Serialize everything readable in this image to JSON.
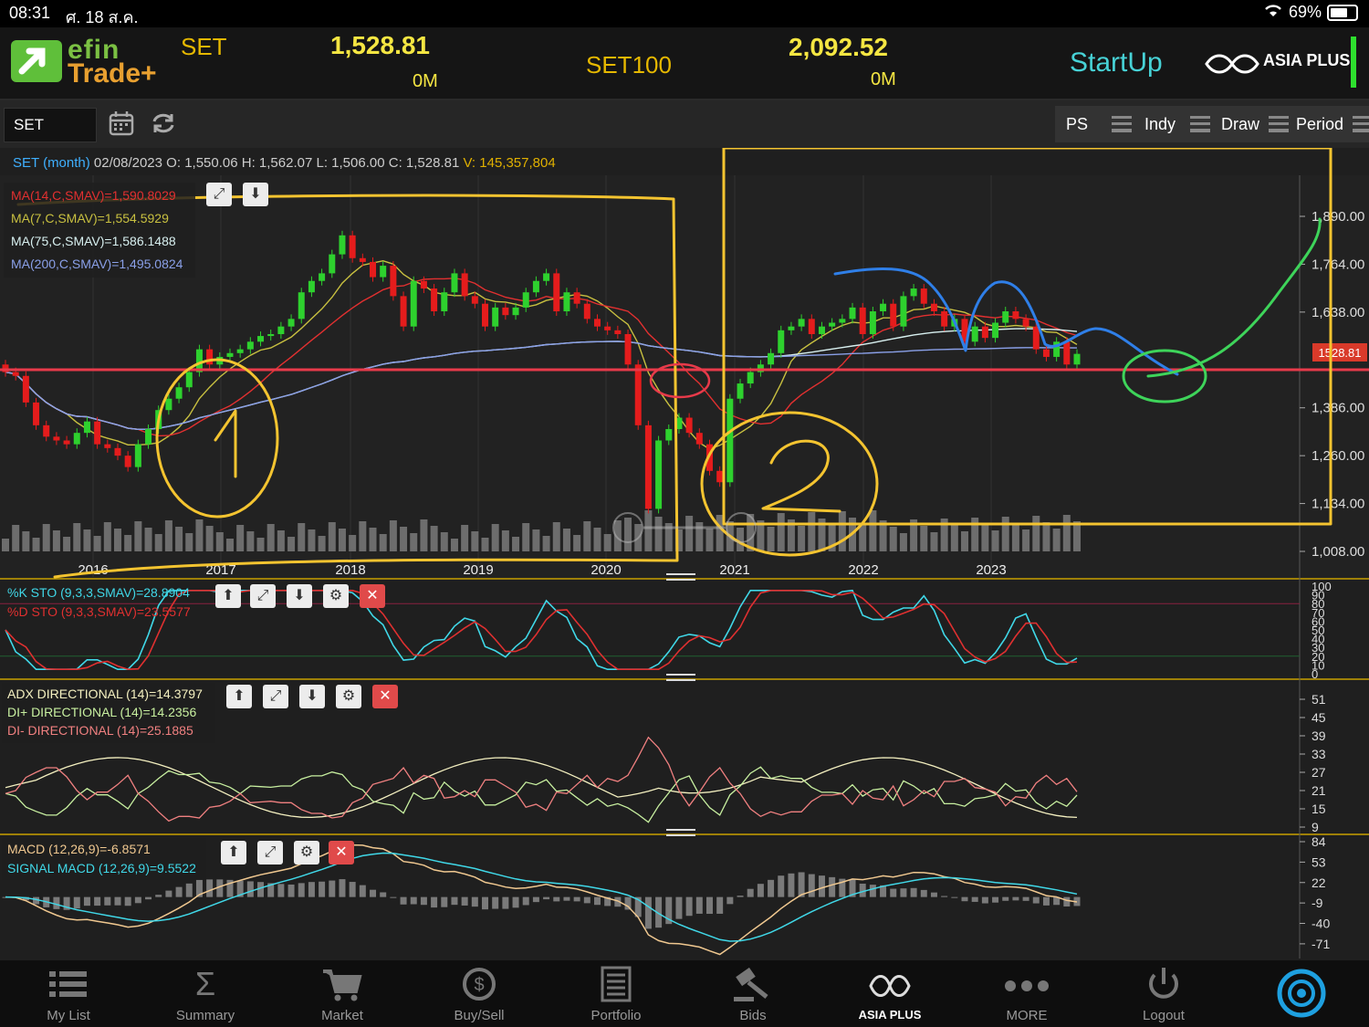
{
  "status_bar": {
    "time": "08:31",
    "date": "ศ. 18 ส.ค.",
    "battery": "69%"
  },
  "header": {
    "brand_top": "efin",
    "brand_bottom": "Trade+",
    "indices": [
      {
        "name": "SET",
        "value": "1,528.81",
        "volume": "0M"
      },
      {
        "name": "SET100",
        "value": "2,092.52",
        "volume": "0M"
      }
    ],
    "startup_label": "StartUp",
    "partner_label": "ASIA PLUS"
  },
  "toolbar": {
    "symbol": "SET",
    "buttons": [
      {
        "label": "PS"
      },
      {
        "label": "Indy"
      },
      {
        "label": "Draw"
      },
      {
        "label": "Period"
      }
    ]
  },
  "ohlc_bar": {
    "symbol": "SET (month)",
    "date": "02/08/2023",
    "open_label": "O:",
    "open": "1,550.06",
    "high_label": "H:",
    "high": "1,562.07",
    "low_label": "L:",
    "low": "1,506.00",
    "close_label": "C:",
    "close": "1,528.81",
    "volume_label": "V:",
    "volume": "145,357,804"
  },
  "main_chart": {
    "ma_legend": [
      {
        "text": "MA(14,C,SMAV)=1,590.8029",
        "color": "#e23030"
      },
      {
        "text": "MA(7,C,SMAV)=1,554.5929",
        "color": "#c8c040"
      },
      {
        "text": "MA(75,C,SMAV)=1,586.1488",
        "color": "#d8f0f0"
      },
      {
        "text": "MA(200,C,SMAV)=1,495.0824",
        "color": "#8aa0e8"
      }
    ],
    "y_ticks": [
      "1,890.00",
      "1,764.00",
      "1,638.00",
      "1,386.00",
      "1,260.00",
      "1,134.00",
      "1,008.00"
    ],
    "x_ticks": [
      "2016",
      "2017",
      "2018",
      "2019",
      "2020",
      "2021",
      "2022",
      "2023"
    ],
    "last_price_tag": "1528.81"
  },
  "stochastic": {
    "legend": [
      {
        "text": "%K STO (9,3,3,SMAV)=28.8904",
        "color": "#40d8e8"
      },
      {
        "text": "%D STO (9,3,3,SMAV)=23.5577",
        "color": "#e03030"
      }
    ],
    "y_ticks": [
      "100",
      "90",
      "80",
      "70",
      "60",
      "50",
      "40",
      "30",
      "20",
      "10",
      "0"
    ]
  },
  "adx": {
    "legend": [
      {
        "text": "ADX DIRECTIONAL (14)=14.3797",
        "color": "#f4f0c0"
      },
      {
        "text": "DI+ DIRECTIONAL (14)=14.2356",
        "color": "#c8f0a0"
      },
      {
        "text": "DI- DIRECTIONAL (14)=25.1885",
        "color": "#f08080"
      }
    ],
    "y_ticks": [
      "51",
      "45",
      "39",
      "33",
      "27",
      "21",
      "15",
      "9"
    ]
  },
  "macd": {
    "legend": [
      {
        "text": "MACD (12,26,9)=-6.8571",
        "color": "#f0c890"
      },
      {
        "text": "SIGNAL MACD (12,26,9)=9.5522",
        "color": "#40d8e8"
      }
    ],
    "y_ticks": [
      "84",
      "53",
      "22",
      "-9",
      "-40",
      "-71"
    ]
  },
  "annotations": {
    "circle_one": "1",
    "circle_two": "2"
  },
  "bottom_nav": [
    {
      "label": "My List",
      "icon": "list-icon"
    },
    {
      "label": "Summary",
      "icon": "sigma-icon"
    },
    {
      "label": "Market",
      "icon": "cart-icon"
    },
    {
      "label": "Buy/Sell",
      "icon": "buysell-icon"
    },
    {
      "label": "Portfolio",
      "icon": "portfolio-icon"
    },
    {
      "label": "Bids",
      "icon": "gavel-icon"
    },
    {
      "label": "ASIA PLUS",
      "icon": "asiaplus-icon"
    },
    {
      "label": "MORE",
      "icon": "more-icon"
    },
    {
      "label": "Logout",
      "icon": "power-icon"
    }
  ],
  "colors": {
    "up": "#2ed12e",
    "down": "#e51c1c",
    "annotation_yellow": "#f4c430",
    "annotation_blue": "#2f7fe8",
    "annotation_green": "#3ed45a",
    "support_line": "#e83a4a"
  }
}
